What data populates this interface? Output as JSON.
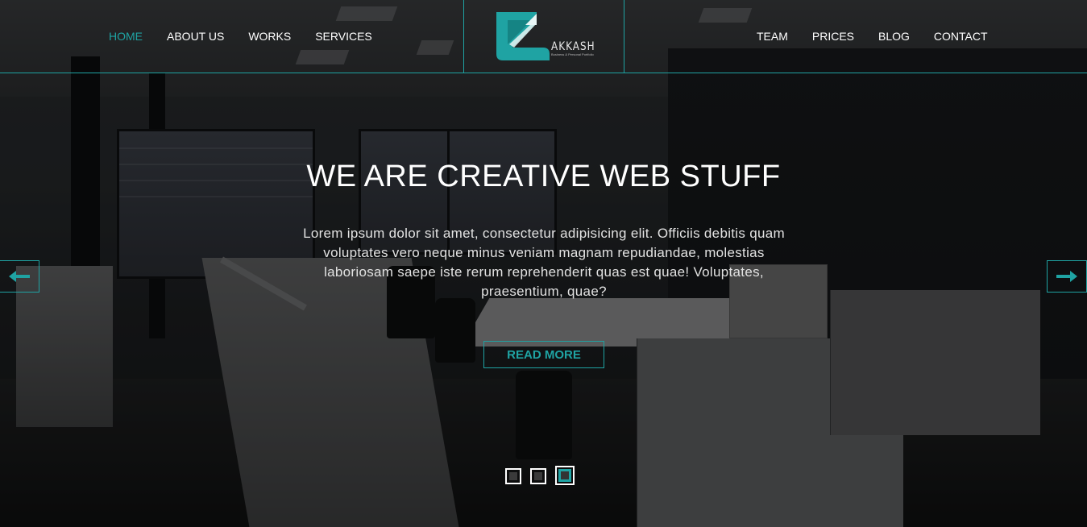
{
  "nav": {
    "left": [
      {
        "label": "HOME",
        "active": true
      },
      {
        "label": "ABOUT US",
        "active": false
      },
      {
        "label": "WORKS",
        "active": false
      },
      {
        "label": "SERVICES",
        "active": false
      }
    ],
    "right": [
      {
        "label": "TEAM"
      },
      {
        "label": "PRICES"
      },
      {
        "label": "BLOG"
      },
      {
        "label": "CONTACT"
      }
    ]
  },
  "logo": {
    "word": "AKKASH",
    "tagline": "Business & Personal Portfolio",
    "icon": "z-logo-icon"
  },
  "hero": {
    "title": "WE ARE CREATIVE WEB STUFF",
    "text": "Lorem ipsum dolor sit amet, consectetur adipisicing elit. Officiis debitis quam voluptates vero neque minus veniam magnam repudiandae, molestias laboriosam saepe iste rerum reprehenderit quas est quae! Voluptates, praesentium, quae?",
    "button": "READ MORE"
  },
  "slider": {
    "prev_icon": "arrow-left-icon",
    "next_icon": "arrow-right-icon",
    "slides": 3,
    "active_slide": 3
  },
  "colors": {
    "accent": "#1fa3a3",
    "text": "#ffffff"
  }
}
